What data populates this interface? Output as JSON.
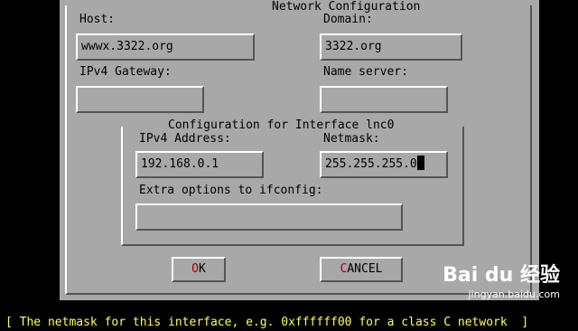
{
  "dialog": {
    "title": "Network Configuration",
    "host": {
      "label": "Host:",
      "value": "wwwx.3322.org"
    },
    "domain": {
      "label": "Domain:",
      "value": "3322.org"
    },
    "gateway": {
      "label": "IPv4 Gateway:",
      "value": ""
    },
    "nameserver": {
      "label": "Name server:",
      "value": ""
    },
    "interface": {
      "title": "Configuration for Interface lnc0",
      "ipv4": {
        "label": "IPv4 Address:",
        "value": "192.168.0.1"
      },
      "netmask": {
        "label": "Netmask:",
        "value": "255.255.255.0"
      },
      "extra": {
        "label": "Extra options to ifconfig:",
        "value": ""
      }
    },
    "buttons": {
      "ok_hotkey": "O",
      "ok_rest": "K",
      "cancel_hotkey": "C",
      "cancel_rest": "ANCEL"
    }
  },
  "status_line": "[ The netmask for this interface, e.g. 0xffffff00 for a class C network  ]",
  "watermark": {
    "main": "Bai du 经验",
    "sub": "jingyan.baidu.com"
  }
}
